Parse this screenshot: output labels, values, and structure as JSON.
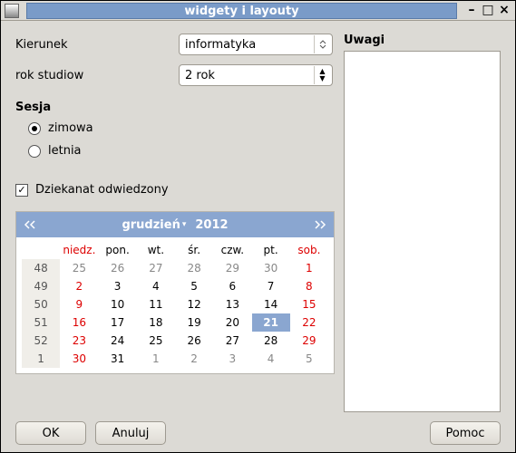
{
  "window_title": "widgety i layouty",
  "form": {
    "direction_label": "Kierunek",
    "direction_value": "informatyka",
    "year_label": "rok studiow",
    "year_value": "2 rok",
    "session_label": "Sesja",
    "session_options": {
      "winter": "zimowa",
      "summer": "letnia"
    },
    "session_selected": "zimowa",
    "dean_visited_label": "Dziekanat odwiedzony",
    "dean_visited_checked": true
  },
  "calendar": {
    "month": "grudzień",
    "year": "2012",
    "headers": [
      "",
      "niedz.",
      "pon.",
      "wt.",
      "śr.",
      "czw.",
      "pt.",
      "sob."
    ],
    "selected_day": 21,
    "rows": [
      {
        "wk": "48",
        "d": [
          "25",
          "26",
          "27",
          "28",
          "29",
          "30",
          "1"
        ],
        "other": [
          0,
          1,
          2,
          3,
          4,
          5
        ],
        "red": [
          6
        ]
      },
      {
        "wk": "49",
        "d": [
          "2",
          "3",
          "4",
          "5",
          "6",
          "7",
          "8"
        ],
        "red": [
          0,
          6
        ]
      },
      {
        "wk": "50",
        "d": [
          "9",
          "10",
          "11",
          "12",
          "13",
          "14",
          "15"
        ],
        "red": [
          0,
          6
        ]
      },
      {
        "wk": "51",
        "d": [
          "16",
          "17",
          "18",
          "19",
          "20",
          "21",
          "22"
        ],
        "red": [
          0,
          6
        ],
        "sel": 5
      },
      {
        "wk": "52",
        "d": [
          "23",
          "24",
          "25",
          "26",
          "27",
          "28",
          "29"
        ],
        "red": [
          0,
          6
        ]
      },
      {
        "wk": "1",
        "d": [
          "30",
          "31",
          "1",
          "2",
          "3",
          "4",
          "5"
        ],
        "other": [
          2,
          3,
          4,
          5,
          6
        ],
        "red": [
          0,
          6
        ]
      }
    ]
  },
  "notes_label": "Uwagi",
  "buttons": {
    "ok": "OK",
    "cancel": "Anuluj",
    "help": "Pomoc"
  }
}
